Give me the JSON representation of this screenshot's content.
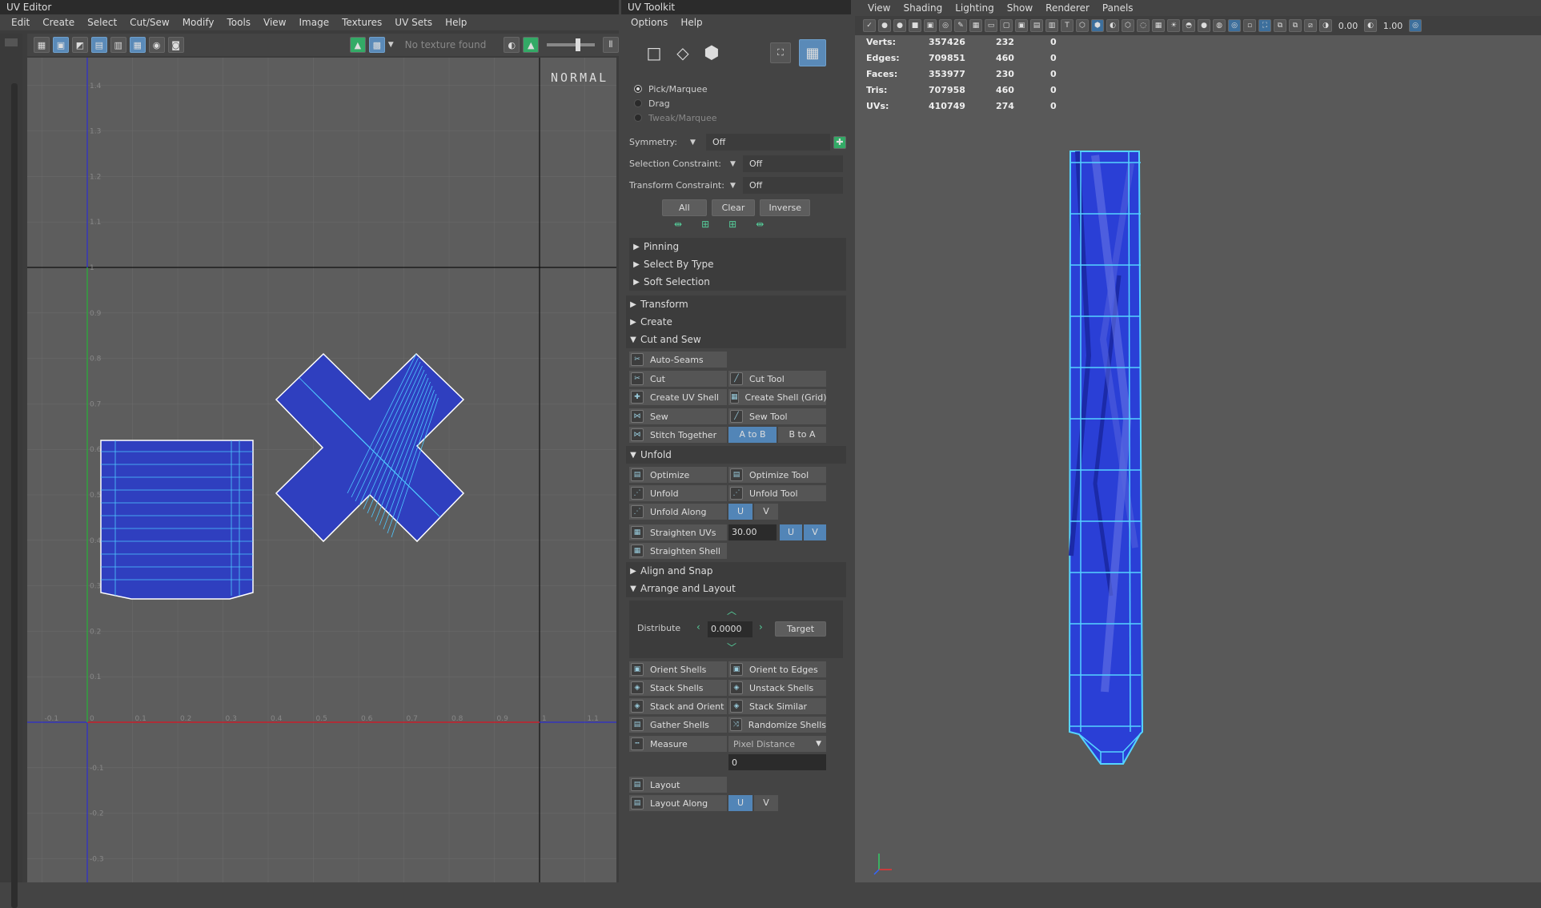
{
  "uv_editor": {
    "title": "UV Editor",
    "menu": [
      "Edit",
      "Create",
      "Select",
      "Cut/Sew",
      "Modify",
      "Tools",
      "View",
      "Image",
      "Textures",
      "UV Sets",
      "Help"
    ],
    "texture_status": "No texture found",
    "mode_label": "NORMAL",
    "axis_x_ticks": [
      "-0.1",
      "0",
      "0.1",
      "0.2",
      "0.3",
      "0.4",
      "0.5",
      "0.6",
      "0.7",
      "0.8",
      "0.9",
      "1",
      "1.1"
    ],
    "axis_y_ticks": [
      "1.4",
      "1.3",
      "1.2",
      "1.1",
      "1",
      "0.9",
      "0.8",
      "0.7",
      "0.6",
      "0.5",
      "0.4",
      "0.3",
      "0.2",
      "0.1",
      "-0.1",
      "-0.2",
      "-0.3"
    ]
  },
  "toolkit": {
    "title": "UV Toolkit",
    "menu": [
      "Options",
      "Help"
    ],
    "modes": [
      "Pick/Marquee",
      "Drag",
      "Tweak/Marquee"
    ],
    "selected_mode": "Pick/Marquee",
    "symmetry": {
      "label": "Symmetry:",
      "value": "Off"
    },
    "selection_constraint": {
      "label": "Selection Constraint:",
      "value": "Off"
    },
    "transform_constraint": {
      "label": "Transform Constraint:",
      "value": "Off"
    },
    "sel_buttons": [
      "All",
      "Clear",
      "Inverse"
    ],
    "sections": {
      "pinning": "Pinning",
      "select_by_type": "Select By Type",
      "soft_selection": "Soft Selection",
      "transform": "Transform",
      "create": "Create",
      "cut_and_sew": "Cut and Sew",
      "unfold": "Unfold",
      "align_and_snap": "Align and Snap",
      "arrange_and_layout": "Arrange and Layout"
    },
    "cut_sew": {
      "auto_seams": "Auto-Seams",
      "cut": "Cut",
      "cut_tool": "Cut Tool",
      "create_uv_shell": "Create UV Shell",
      "create_shell_grid": "Create Shell (Grid)",
      "sew": "Sew",
      "sew_tool": "Sew Tool",
      "stitch_together": "Stitch Together",
      "a_to_b": "A to B",
      "b_to_a": "B to A"
    },
    "unfold": {
      "optimize": "Optimize",
      "optimize_tool": "Optimize Tool",
      "unfold": "Unfold",
      "unfold_tool": "Unfold Tool",
      "unfold_along": "Unfold Along",
      "u": "U",
      "v": "V",
      "straighten_uvs": "Straighten UVs",
      "straighten_value": "30.00",
      "straighten_shell": "Straighten Shell"
    },
    "arrange": {
      "distribute": "Distribute",
      "distribute_value": "0.0000",
      "target": "Target",
      "orient_shells": "Orient Shells",
      "orient_to_edges": "Orient to Edges",
      "stack_shells": "Stack Shells",
      "unstack_shells": "Unstack Shells",
      "stack_and_orient": "Stack and Orient",
      "stack_similar": "Stack Similar",
      "gather_shells": "Gather Shells",
      "randomize_shells": "Randomize Shells",
      "measure": "Measure",
      "measure_mode": "Pixel Distance",
      "measure_value": "0",
      "layout": "Layout",
      "layout_along": "Layout Along"
    }
  },
  "viewport": {
    "menu": [
      "View",
      "Shading",
      "Lighting",
      "Show",
      "Renderer",
      "Panels"
    ],
    "field_a": "0.00",
    "field_b": "1.00",
    "hud": [
      {
        "k": "Verts:",
        "a": "357426",
        "b": "232",
        "c": "0"
      },
      {
        "k": "Edges:",
        "a": "709851",
        "b": "460",
        "c": "0"
      },
      {
        "k": "Faces:",
        "a": "353977",
        "b": "230",
        "c": "0"
      },
      {
        "k": "Tris:",
        "a": "707958",
        "b": "460",
        "c": "0"
      },
      {
        "k": "UVs:",
        "a": "410749",
        "b": "274",
        "c": "0"
      }
    ],
    "colors": {
      "mesh": "#2a3fd6",
      "wire": "#55d4ff",
      "bg": "#595959"
    }
  }
}
